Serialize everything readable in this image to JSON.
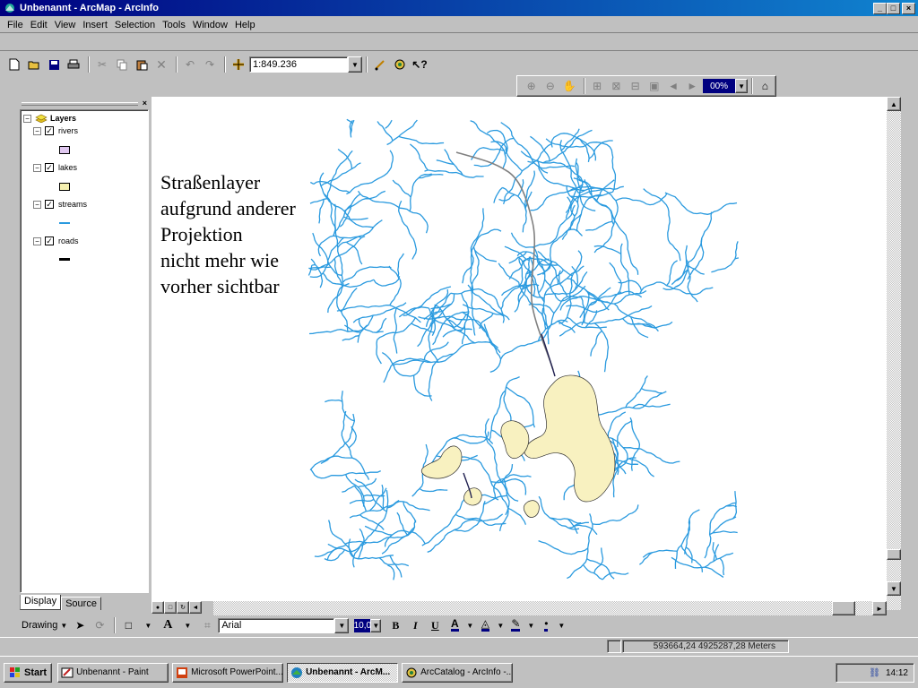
{
  "window": {
    "title": "Unbenannt - ArcMap - ArcInfo",
    "controls": {
      "minimize": "_",
      "maximize": "□",
      "close": "×"
    }
  },
  "menu": [
    "File",
    "Edit",
    "View",
    "Insert",
    "Selection",
    "Tools",
    "Window",
    "Help"
  ],
  "toolbar": {
    "scale_value": "1:849.236",
    "zoom_percent": "00%"
  },
  "toc": {
    "root_label": "Layers",
    "layers": [
      {
        "name": "rivers",
        "checked": true,
        "symbol_color": "#e0c8f0",
        "symbol_type": "fill"
      },
      {
        "name": "lakes",
        "checked": true,
        "symbol_color": "#f5f0b0",
        "symbol_type": "fill"
      },
      {
        "name": "streams",
        "checked": true,
        "symbol_color": "#2a9adf",
        "symbol_type": "line"
      },
      {
        "name": "roads",
        "checked": true,
        "symbol_color": "#000000",
        "symbol_type": "line"
      }
    ],
    "tabs": {
      "display": "Display",
      "source": "Source"
    }
  },
  "map": {
    "annotation": "Straßenlayer\naufgrund anderer\nProjektion\nnicht mehr wie\nvorher sichtbar",
    "stream_color": "#2a9adf",
    "lake_color": "#f8f1c0",
    "road_color": "#808080"
  },
  "drawing_toolbar": {
    "label": "Drawing",
    "font_name": "Arial",
    "font_size": "10,0",
    "bold": "B",
    "italic": "I",
    "underline": "U",
    "text_tool": "A"
  },
  "status": {
    "coordinates": "593664,24  4925287,28 Meters"
  },
  "taskbar": {
    "start_label": "Start",
    "tasks": [
      {
        "label": "Unbenannt - Paint",
        "active": false
      },
      {
        "label": "Microsoft PowerPoint...",
        "active": false
      },
      {
        "label": "Unbenannt - ArcM...",
        "active": true
      },
      {
        "label": "ArcCatalog - ArcInfo -...",
        "active": false
      }
    ],
    "clock": "14:12"
  }
}
